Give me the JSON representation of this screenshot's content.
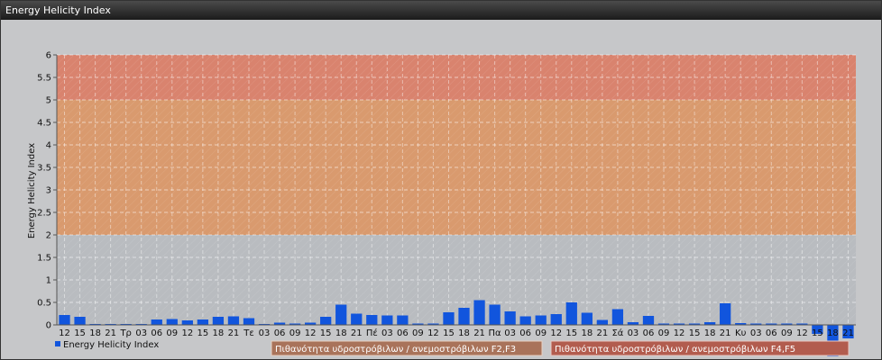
{
  "window": {
    "title": "Energy Helicity Index"
  },
  "chart_data": {
    "type": "bar",
    "title": "",
    "ylabel": "Energy Helicity Index",
    "xlabel": "",
    "ylim": [
      0,
      6
    ],
    "yticks": [
      "0",
      "0.5",
      "1",
      "1.5",
      "2",
      "2.5",
      "3",
      "3.5",
      "4",
      "4.5",
      "5",
      "5.5",
      "6"
    ],
    "categories": [
      "12",
      "15",
      "18",
      "21",
      "Τρ",
      "03",
      "06",
      "09",
      "12",
      "15",
      "18",
      "21",
      "Τε",
      "03",
      "06",
      "09",
      "12",
      "15",
      "18",
      "21",
      "Πέ",
      "03",
      "06",
      "09",
      "12",
      "15",
      "18",
      "21",
      "Πα",
      "03",
      "06",
      "09",
      "12",
      "15",
      "18",
      "21",
      "Σά",
      "03",
      "06",
      "09",
      "12",
      "15",
      "18",
      "21",
      "Κυ",
      "03",
      "06",
      "09",
      "12",
      "15",
      "18",
      "21"
    ],
    "series": [
      {
        "name": "Energy Helicity Index",
        "color": "#1155dd",
        "values": [
          0.22,
          0.18,
          0.02,
          0.02,
          0.02,
          0.02,
          0.12,
          0.13,
          0.1,
          0.12,
          0.18,
          0.19,
          0.15,
          0.02,
          0.05,
          0.03,
          0.05,
          0.18,
          0.45,
          0.25,
          0.22,
          0.21,
          0.21,
          0.03,
          0.03,
          0.28,
          0.38,
          0.55,
          0.45,
          0.3,
          0.19,
          0.21,
          0.24,
          0.5,
          0.27,
          0.11,
          0.35,
          0.06,
          0.2,
          0.03,
          0.03,
          0.03,
          0.06,
          0.48,
          0.04,
          0.03,
          0.03,
          0.03,
          0.03,
          -0.2,
          -0.7,
          -0.3
        ]
      }
    ],
    "zones": [
      {
        "from": 2,
        "to": 5,
        "color": "#d99a6e",
        "label": "Πιθανότητα υδροστρόβιλων / ανεμοστρόβιλων F2,F3"
      },
      {
        "from": 5,
        "to": 6,
        "color": "#d9836e",
        "label": "Πιθανότητα υδροστρόβιλων / ανεμοστρόβιλων F4,F5"
      }
    ],
    "grid": true,
    "legend": "bottom-left"
  }
}
